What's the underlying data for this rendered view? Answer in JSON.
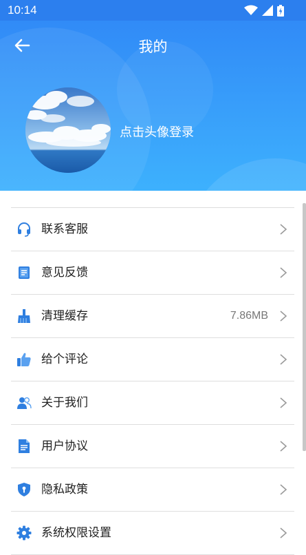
{
  "status_bar": {
    "time": "10:14"
  },
  "header": {
    "title": "我的",
    "login_prompt": "点击头像登录"
  },
  "colors": {
    "header_gradient_top": "#2f86f6",
    "header_gradient_bottom": "#3db1fd",
    "icon_blue": "#2f7fe0"
  },
  "menu": [
    {
      "label": "联系客服",
      "icon": "headset-icon"
    },
    {
      "label": "意见反馈",
      "icon": "feedback-icon"
    },
    {
      "label": "清理缓存",
      "icon": "broom-icon",
      "value": "7.86MB"
    },
    {
      "label": "给个评论",
      "icon": "thumbs-up-icon"
    },
    {
      "label": "关于我们",
      "icon": "users-icon"
    },
    {
      "label": "用户协议",
      "icon": "document-icon"
    },
    {
      "label": "隐私政策",
      "icon": "shield-icon"
    },
    {
      "label": "系统权限设置",
      "icon": "gear-icon"
    }
  ]
}
